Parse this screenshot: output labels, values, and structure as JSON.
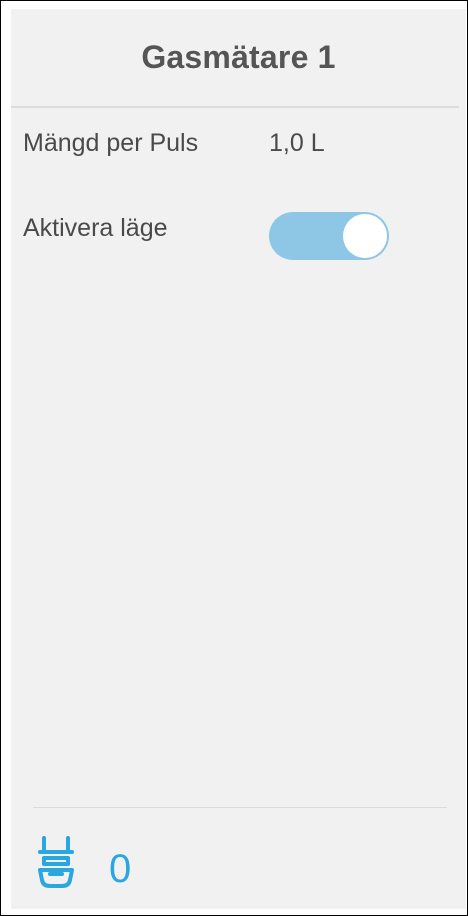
{
  "header": {
    "title": "Gasmätare 1"
  },
  "settings": {
    "amount_per_pulse": {
      "label": "Mängd per Puls",
      "value": "1,0 L"
    },
    "activate_mode": {
      "label": "Aktivera läge",
      "enabled": true
    }
  },
  "footer": {
    "icon": "gas-meter-icon",
    "count": "0"
  },
  "colors": {
    "accent": "#2aa6e0",
    "toggle_on": "#8ec7e6",
    "panel_bg": "#f1f1f1",
    "text": "#4a4a4a",
    "title": "#555555"
  }
}
